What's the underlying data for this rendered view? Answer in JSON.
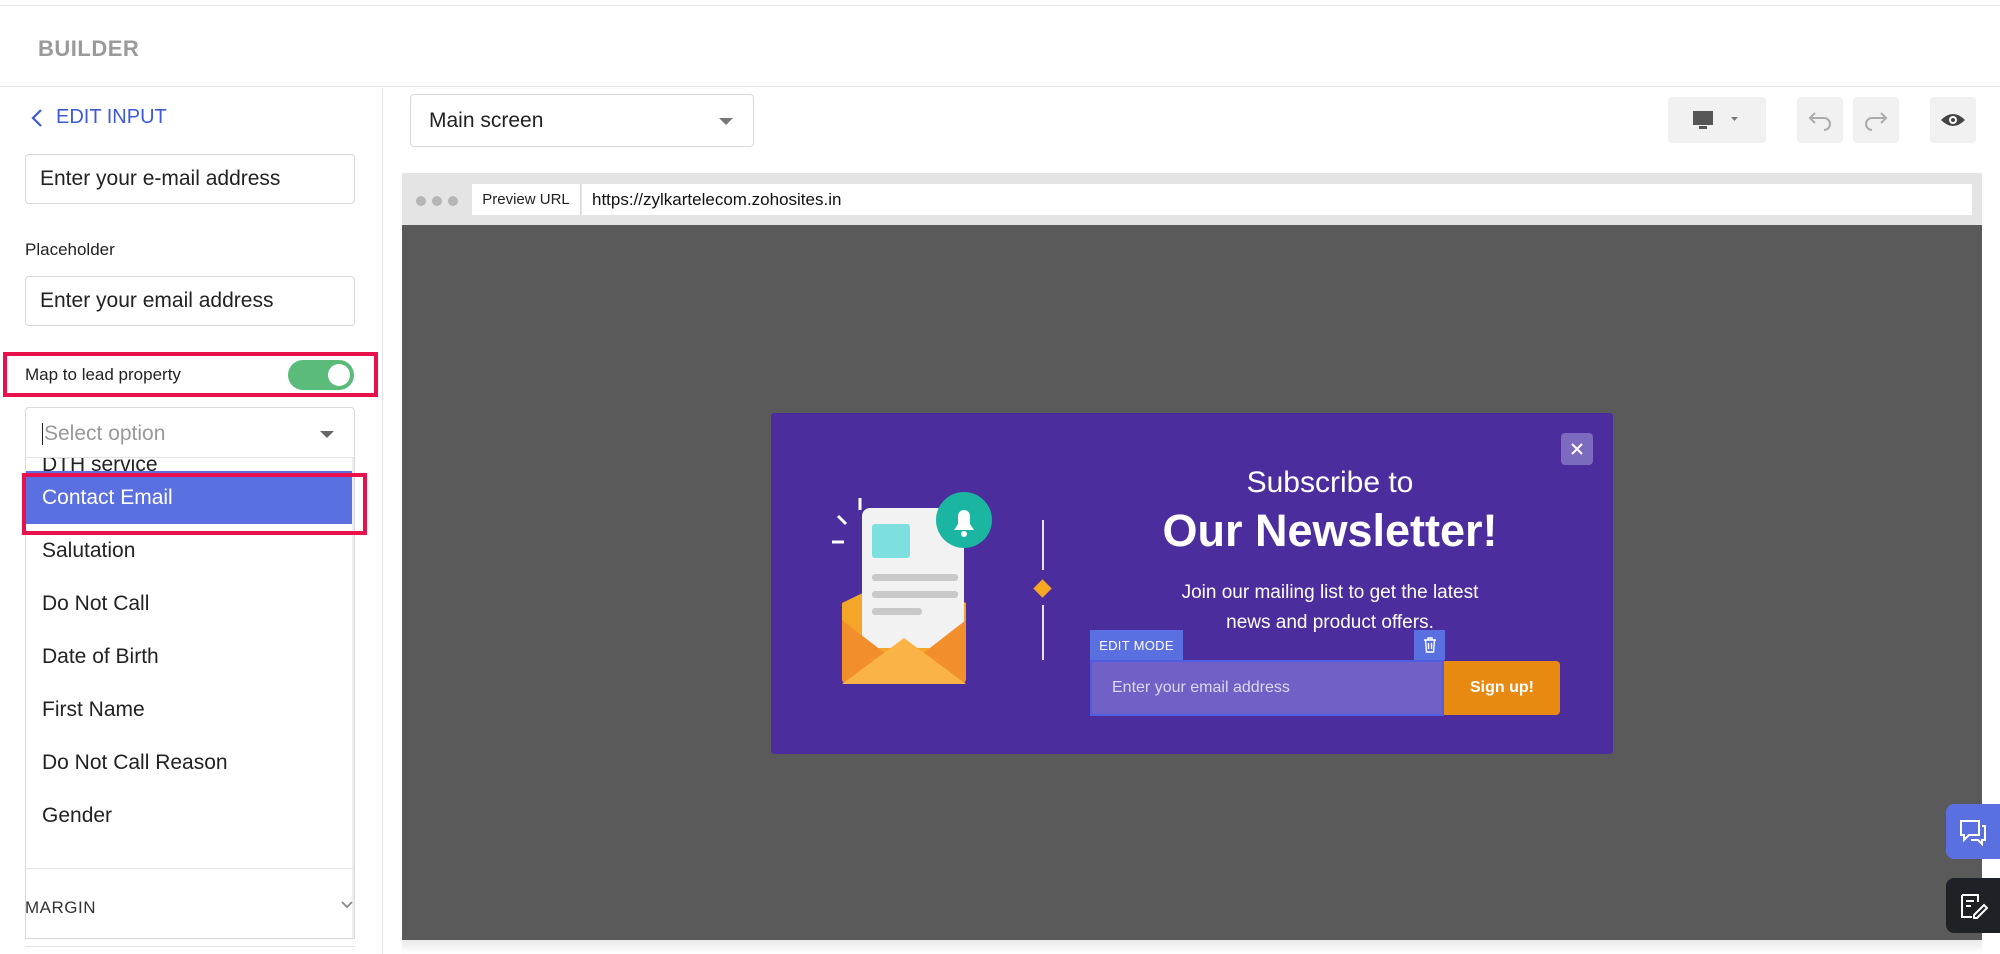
{
  "app": {
    "title": "BUILDER"
  },
  "sidebar": {
    "back_label": "EDIT INPUT",
    "label_value": "Enter your e-mail address",
    "placeholder_label": "Placeholder",
    "placeholder_value": "Enter your email address",
    "map_label": "Map to lead property",
    "map_enabled": true,
    "select_placeholder": "Select option",
    "options": [
      "DTH service",
      "Contact Email",
      "Salutation",
      "Do Not Call",
      "Date of Birth",
      "First Name",
      "Do Not Call Reason",
      "Gender"
    ],
    "selected_option": "Contact Email",
    "margin_label": "MARGIN"
  },
  "toolbar": {
    "screen_select": "Main screen",
    "device_icon": "desktop-icon",
    "undo_icon": "undo-icon",
    "redo_icon": "redo-icon",
    "preview_icon": "eye-icon"
  },
  "preview": {
    "url_label": "Preview URL",
    "url": "https://zylkartelecom.zohosites.in"
  },
  "popup": {
    "title_line1": "Subscribe to",
    "title_line2": "Our Newsletter!",
    "description": "Join our mailing list to get the latest news and product offers.",
    "edit_mode": "EDIT MODE",
    "email_placeholder": "Enter your email address",
    "signup": "Sign up!"
  },
  "colors": {
    "accent": "#5a6fe0",
    "highlight": "#e8114b",
    "toggle_on": "#5bbb7b",
    "popup_bg": "#4b2d9e",
    "signup": "#e88a12"
  }
}
